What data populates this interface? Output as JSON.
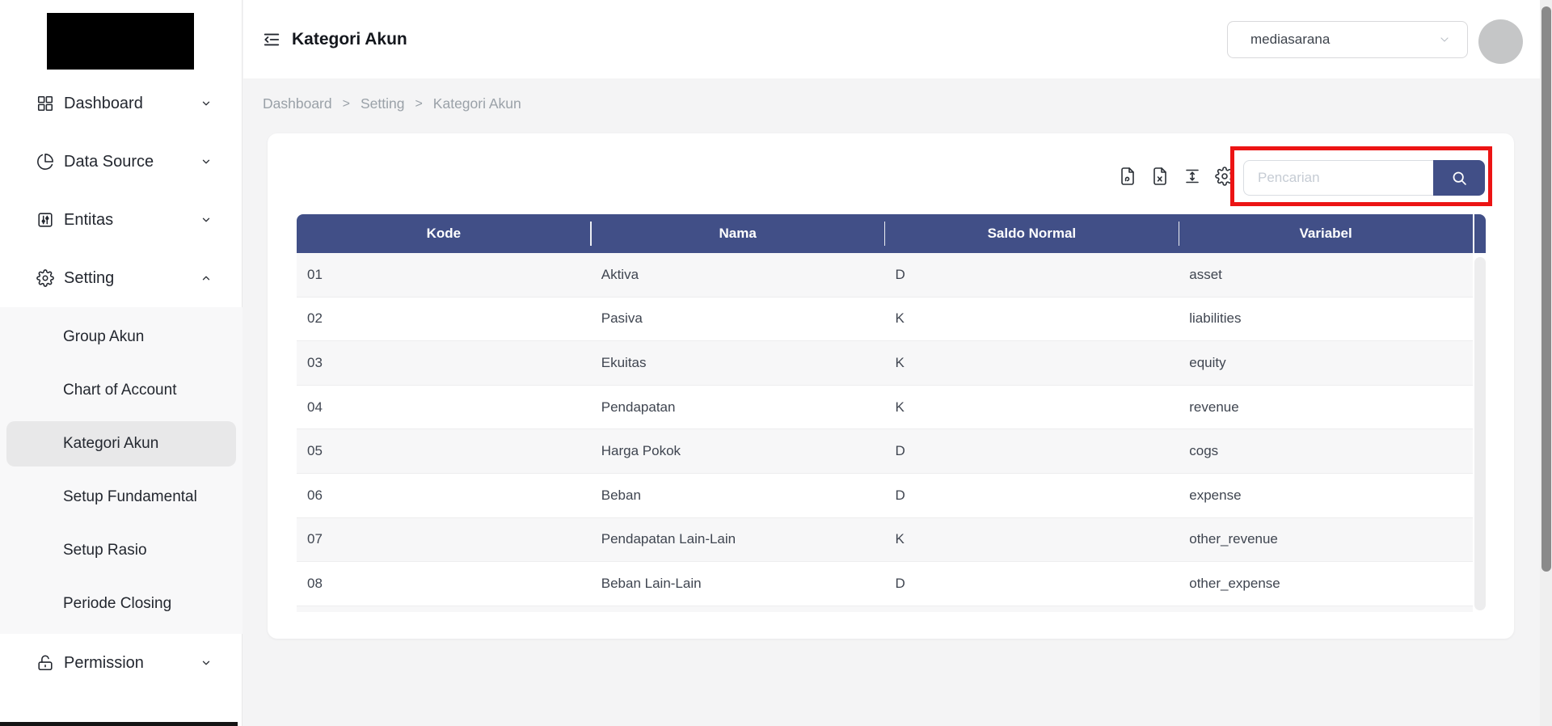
{
  "header": {
    "title": "Kategori Akun",
    "workspace_selector": "mediasarana"
  },
  "breadcrumb": {
    "items": [
      "Dashboard",
      "Setting",
      "Kategori Akun"
    ],
    "separator": ">"
  },
  "sidebar": {
    "items": [
      {
        "label": "Dashboard"
      },
      {
        "label": "Data Source"
      },
      {
        "label": "Entitas"
      },
      {
        "label": "Setting"
      },
      {
        "label": "Permission"
      }
    ],
    "setting_submenu": [
      {
        "label": "Group Akun"
      },
      {
        "label": "Chart of Account"
      },
      {
        "label": "Kategori Akun",
        "active": true
      },
      {
        "label": "Setup Fundamental"
      },
      {
        "label": "Setup Rasio"
      },
      {
        "label": "Periode Closing"
      }
    ]
  },
  "card": {
    "search_placeholder": "Pencarian"
  },
  "table": {
    "columns": [
      "Kode",
      "Nama",
      "Saldo Normal",
      "Variabel"
    ],
    "rows": [
      {
        "kode": "01",
        "nama": "Aktiva",
        "saldo_normal": "D",
        "variabel": "asset"
      },
      {
        "kode": "02",
        "nama": "Pasiva",
        "saldo_normal": "K",
        "variabel": "liabilities"
      },
      {
        "kode": "03",
        "nama": "Ekuitas",
        "saldo_normal": "K",
        "variabel": "equity"
      },
      {
        "kode": "04",
        "nama": "Pendapatan",
        "saldo_normal": "K",
        "variabel": "revenue"
      },
      {
        "kode": "05",
        "nama": "Harga Pokok",
        "saldo_normal": "D",
        "variabel": "cogs"
      },
      {
        "kode": "06",
        "nama": "Beban",
        "saldo_normal": "D",
        "variabel": "expense"
      },
      {
        "kode": "07",
        "nama": "Pendapatan Lain-Lain",
        "saldo_normal": "K",
        "variabel": "other_revenue"
      },
      {
        "kode": "08",
        "nama": "Beban Lain-Lain",
        "saldo_normal": "D",
        "variabel": "other_expense"
      }
    ]
  },
  "colors": {
    "primary": "#414f87",
    "annotation_red": "#ec1414",
    "row_alt": "#f7f7f8",
    "content_bg": "#f4f4f5",
    "avatar_gray": "#c5c6c7"
  }
}
